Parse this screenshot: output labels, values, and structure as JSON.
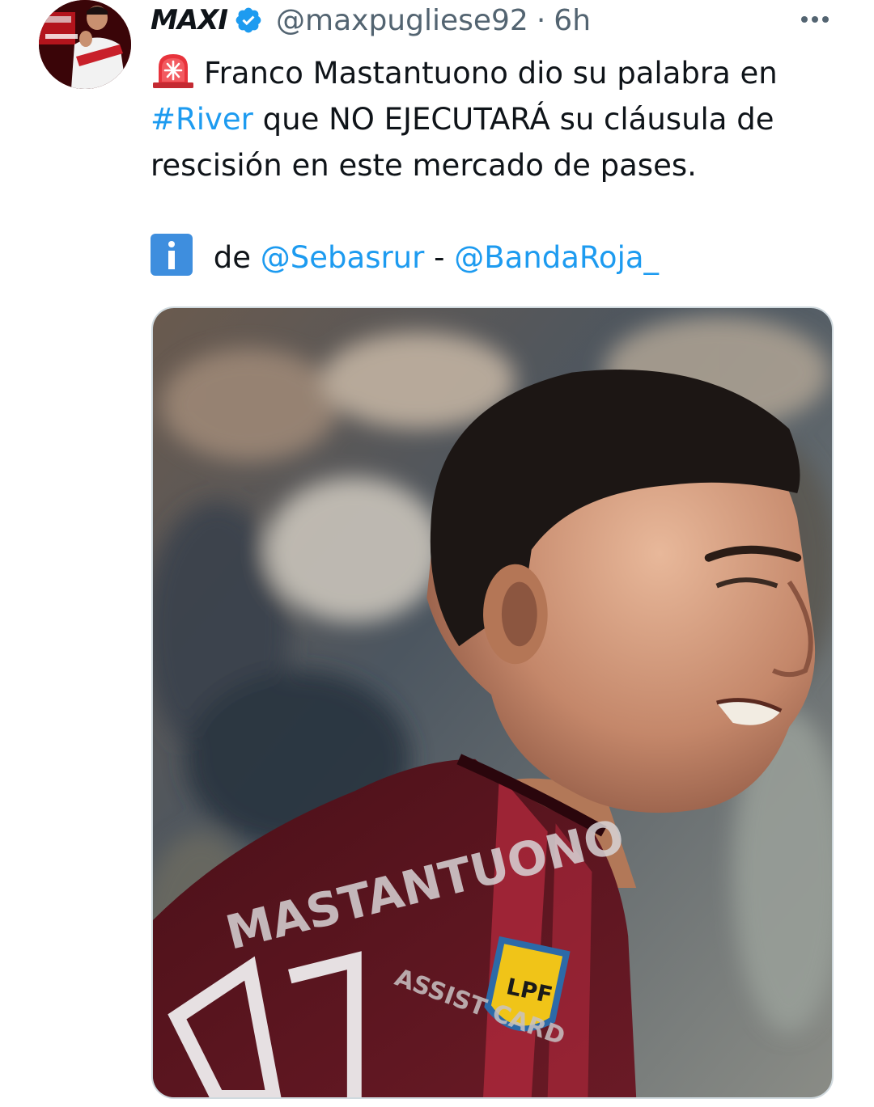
{
  "tweet": {
    "author": {
      "display_name": "MAXI",
      "handle": "@maxpugliese92",
      "verified": true,
      "avatar_icon": "profile-avatar"
    },
    "separator": "·",
    "time": "6h",
    "more_icon": "more-horizontal-icon",
    "text": {
      "line1": "Franco Mastantuono dio su palabra en",
      "hashtag": "#River",
      "line2_rest": " que NO EJECUTARÁ su cláusula de",
      "line3": "rescisión en este mercado de pases.",
      "source_prefix": " de ",
      "mention1": "@Sebasrur",
      "mention_sep": " - ",
      "mention2": "@BandaRoja_"
    },
    "emojis": [
      "siren-emoji",
      "information-emoji"
    ],
    "media": {
      "type": "photo",
      "description_icon": "player-photo"
    }
  },
  "colors": {
    "link": "#1d9bf0",
    "text": "#0f1419",
    "secondary": "#536471",
    "verified": "#1d9bf0",
    "jersey": "#5a1420"
  }
}
